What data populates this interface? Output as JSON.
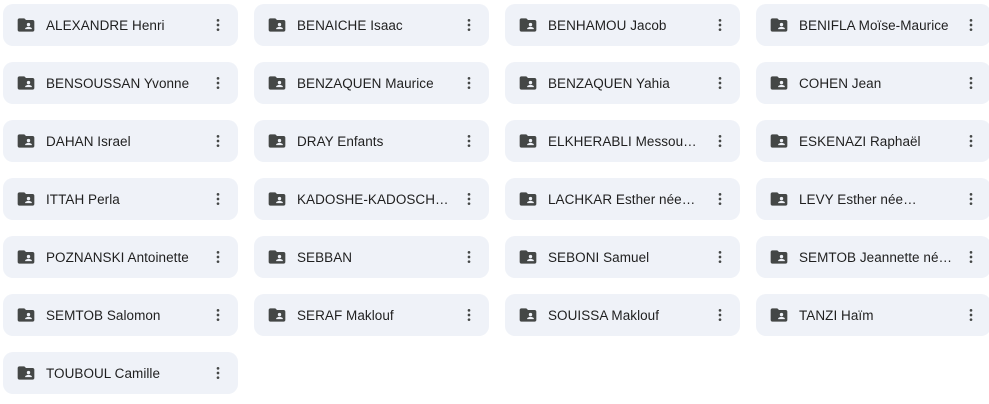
{
  "folders": [
    {
      "name": "ALEXANDRE Henri"
    },
    {
      "name": "BENAICHE Isaac"
    },
    {
      "name": "BENHAMOU Jacob"
    },
    {
      "name": "BENIFLA Moïse-Maurice"
    },
    {
      "name": "BENSOUSSAN Yvonne"
    },
    {
      "name": "BENZAQUEN Maurice"
    },
    {
      "name": "BENZAQUEN Yahia"
    },
    {
      "name": "COHEN Jean"
    },
    {
      "name": "DAHAN Israel"
    },
    {
      "name": "DRAY Enfants"
    },
    {
      "name": "ELKHERABLI Messouda-…"
    },
    {
      "name": "ESKENAZI Raphaël"
    },
    {
      "name": "ITTAH Perla"
    },
    {
      "name": "KADOSHE-KADOSCHE…"
    },
    {
      "name": "LACHKAR Esther née…"
    },
    {
      "name": "LEVY Esther née…"
    },
    {
      "name": "POZNANSKI Antoinette"
    },
    {
      "name": "SEBBAN"
    },
    {
      "name": "SEBONI Samuel"
    },
    {
      "name": "SEMTOB Jeannette née…"
    },
    {
      "name": "SEMTOB Salomon"
    },
    {
      "name": "SERAF Maklouf"
    },
    {
      "name": "SOUISSA Maklouf"
    },
    {
      "name": "TANZI Haïm"
    },
    {
      "name": "TOUBOUL Camille"
    }
  ],
  "icons": {
    "folder": "shared-folder-icon",
    "more": "more-vert-icon"
  },
  "colors": {
    "card_background": "#eff2f8",
    "icon": "#444746",
    "text": "#1f1f1f"
  }
}
